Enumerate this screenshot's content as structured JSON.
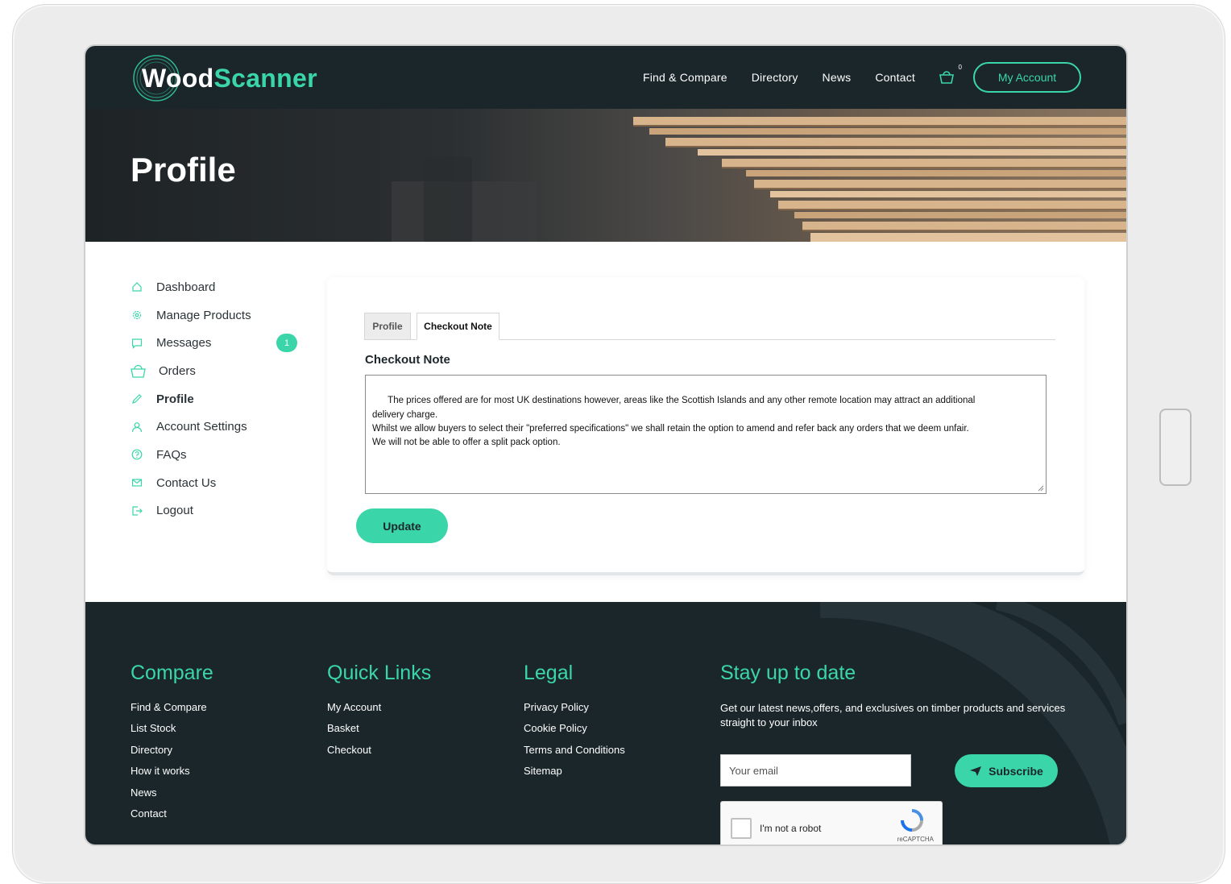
{
  "header": {
    "logo": {
      "part1": "Wood",
      "part2": "Scanner"
    },
    "nav": [
      "Find & Compare",
      "Directory",
      "News",
      "Contact"
    ],
    "cart_count": "0",
    "account_label": "My Account"
  },
  "hero": {
    "title": "Profile"
  },
  "sidebar": {
    "items": [
      {
        "label": "Dashboard",
        "icon": "home-icon"
      },
      {
        "label": "Manage Products",
        "icon": "gear-icon"
      },
      {
        "label": "Messages",
        "icon": "chat-icon",
        "badge": "1"
      },
      {
        "label": "Orders",
        "icon": "basket-icon"
      },
      {
        "label": "Profile",
        "icon": "pencil-icon",
        "active": true
      },
      {
        "label": "Account Settings",
        "icon": "user-icon"
      },
      {
        "label": "FAQs",
        "icon": "question-icon"
      },
      {
        "label": "Contact Us",
        "icon": "mail-icon"
      },
      {
        "label": "Logout",
        "icon": "logout-icon"
      }
    ]
  },
  "card": {
    "tabs": [
      "Profile",
      "Checkout Note"
    ],
    "active_tab": "Checkout Note",
    "section_title": "Checkout Note",
    "note_text": "The prices offered are for most UK destinations however, areas like the Scottish Islands and any other remote location may attract an additional\ndelivery charge.\nWhilst we allow buyers to select their \"preferred specifications\" we shall retain the option to amend and refer back any orders that we deem unfair.\nWe will not be able to offer a split pack option.",
    "update_label": "Update"
  },
  "footer": {
    "compare": {
      "title": "Compare",
      "links": [
        "Find & Compare",
        "List Stock",
        "Directory",
        "How it works",
        "News",
        "Contact"
      ]
    },
    "quick_links": {
      "title": "Quick Links",
      "links": [
        "My Account",
        "Basket",
        "Checkout"
      ]
    },
    "legal": {
      "title": "Legal",
      "links": [
        "Privacy Policy",
        "Cookie Policy",
        "Terms and Conditions",
        "Sitemap"
      ]
    },
    "subscribe": {
      "title": "Stay up to date",
      "text": "Get our latest news,offers, and exclusives on timber products and services straight to your inbox",
      "email_placeholder": "Your email",
      "button_label": "Subscribe",
      "captcha_label": "I'm not a robot",
      "captcha_brand": "reCAPTCHA"
    }
  },
  "colors": {
    "accent": "#3ad6a9",
    "dark": "#1b262b"
  }
}
